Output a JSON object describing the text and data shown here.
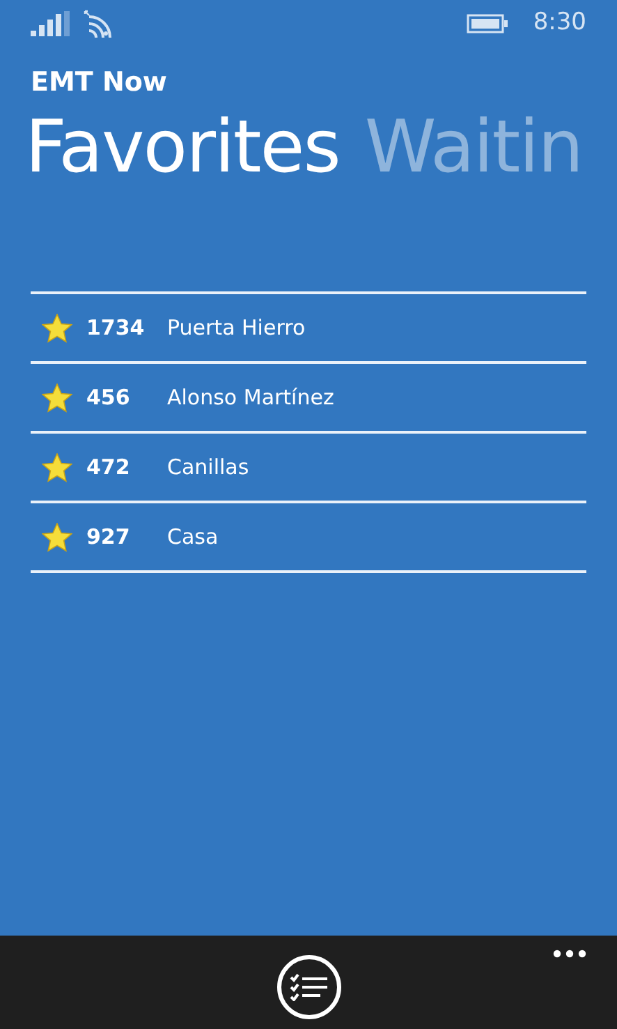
{
  "status_bar": {
    "time": "8:30"
  },
  "app": {
    "title": "EMT Now"
  },
  "pivots": [
    {
      "label": "Favorites",
      "selected": true
    },
    {
      "label": "Waitin",
      "selected": false
    }
  ],
  "favorites": [
    {
      "stop": "1734",
      "name": "Puerta Hierro"
    },
    {
      "stop": "456",
      "name": "Alonso Martínez"
    },
    {
      "stop": "472",
      "name": "Canillas"
    },
    {
      "stop": "927",
      "name": "Casa"
    }
  ]
}
